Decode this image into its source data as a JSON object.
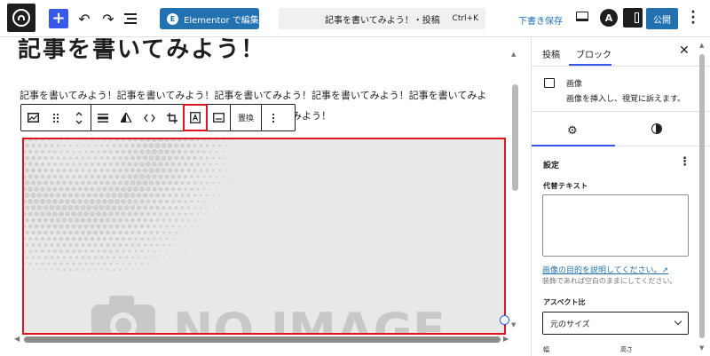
{
  "topbar": {
    "elementor_label": "Elementor で編集",
    "elementor_icon": "E",
    "doc_title": "記事を書いてみよう！・投稿",
    "shortcut": "Ctrl+K",
    "draft_label": "下書き保存",
    "astra_icon": "A",
    "publish_label": "公開"
  },
  "editor": {
    "post_title": "記事を書いてみよう！",
    "paragraph": "記事を書いてみよう！記事を書いてみよう！記事を書いてみよう！記事を書いてみよう！記事を書いてみよう！記事を書いてみよう！記事を書いてみよう！記事を書いてみよう！",
    "toolbar_replace": "置換",
    "image_text": "NO IMAGE"
  },
  "sidebar": {
    "tab_post": "投稿",
    "tab_block": "ブロック",
    "block_name": "画像",
    "block_desc": "画像を挿入し、視覚に訴えます。",
    "settings_heading": "設定",
    "alt_label": "代替テキスト",
    "alt_value": "",
    "alt_link": "画像の目的を説明してください。↗",
    "alt_help": "装飾であれば空白のままにしてください。",
    "aspect_label": "アスペクト比",
    "aspect_value": "元のサイズ",
    "width_label": "幅",
    "height_label": "高さ"
  },
  "colors": {
    "accent": "#3858e9",
    "primary_button": "#2271b1",
    "highlight": "#e0141e"
  }
}
